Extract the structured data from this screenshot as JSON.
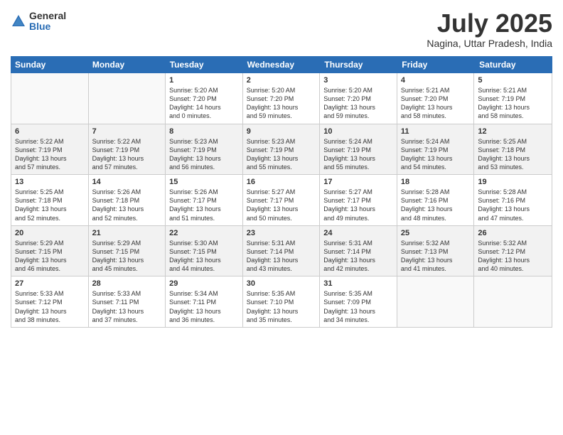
{
  "logo": {
    "general": "General",
    "blue": "Blue"
  },
  "title": "July 2025",
  "location": "Nagina, Uttar Pradesh, India",
  "weekdays": [
    "Sunday",
    "Monday",
    "Tuesday",
    "Wednesday",
    "Thursday",
    "Friday",
    "Saturday"
  ],
  "weeks": [
    [
      {
        "day": "",
        "info": "",
        "empty": true
      },
      {
        "day": "",
        "info": "",
        "empty": true
      },
      {
        "day": "1",
        "info": "Sunrise: 5:20 AM\nSunset: 7:20 PM\nDaylight: 14 hours\nand 0 minutes.",
        "empty": false
      },
      {
        "day": "2",
        "info": "Sunrise: 5:20 AM\nSunset: 7:20 PM\nDaylight: 13 hours\nand 59 minutes.",
        "empty": false
      },
      {
        "day": "3",
        "info": "Sunrise: 5:20 AM\nSunset: 7:20 PM\nDaylight: 13 hours\nand 59 minutes.",
        "empty": false
      },
      {
        "day": "4",
        "info": "Sunrise: 5:21 AM\nSunset: 7:20 PM\nDaylight: 13 hours\nand 58 minutes.",
        "empty": false
      },
      {
        "day": "5",
        "info": "Sunrise: 5:21 AM\nSunset: 7:19 PM\nDaylight: 13 hours\nand 58 minutes.",
        "empty": false
      }
    ],
    [
      {
        "day": "6",
        "info": "Sunrise: 5:22 AM\nSunset: 7:19 PM\nDaylight: 13 hours\nand 57 minutes.",
        "empty": false
      },
      {
        "day": "7",
        "info": "Sunrise: 5:22 AM\nSunset: 7:19 PM\nDaylight: 13 hours\nand 57 minutes.",
        "empty": false
      },
      {
        "day": "8",
        "info": "Sunrise: 5:23 AM\nSunset: 7:19 PM\nDaylight: 13 hours\nand 56 minutes.",
        "empty": false
      },
      {
        "day": "9",
        "info": "Sunrise: 5:23 AM\nSunset: 7:19 PM\nDaylight: 13 hours\nand 55 minutes.",
        "empty": false
      },
      {
        "day": "10",
        "info": "Sunrise: 5:24 AM\nSunset: 7:19 PM\nDaylight: 13 hours\nand 55 minutes.",
        "empty": false
      },
      {
        "day": "11",
        "info": "Sunrise: 5:24 AM\nSunset: 7:19 PM\nDaylight: 13 hours\nand 54 minutes.",
        "empty": false
      },
      {
        "day": "12",
        "info": "Sunrise: 5:25 AM\nSunset: 7:18 PM\nDaylight: 13 hours\nand 53 minutes.",
        "empty": false
      }
    ],
    [
      {
        "day": "13",
        "info": "Sunrise: 5:25 AM\nSunset: 7:18 PM\nDaylight: 13 hours\nand 52 minutes.",
        "empty": false
      },
      {
        "day": "14",
        "info": "Sunrise: 5:26 AM\nSunset: 7:18 PM\nDaylight: 13 hours\nand 52 minutes.",
        "empty": false
      },
      {
        "day": "15",
        "info": "Sunrise: 5:26 AM\nSunset: 7:17 PM\nDaylight: 13 hours\nand 51 minutes.",
        "empty": false
      },
      {
        "day": "16",
        "info": "Sunrise: 5:27 AM\nSunset: 7:17 PM\nDaylight: 13 hours\nand 50 minutes.",
        "empty": false
      },
      {
        "day": "17",
        "info": "Sunrise: 5:27 AM\nSunset: 7:17 PM\nDaylight: 13 hours\nand 49 minutes.",
        "empty": false
      },
      {
        "day": "18",
        "info": "Sunrise: 5:28 AM\nSunset: 7:16 PM\nDaylight: 13 hours\nand 48 minutes.",
        "empty": false
      },
      {
        "day": "19",
        "info": "Sunrise: 5:28 AM\nSunset: 7:16 PM\nDaylight: 13 hours\nand 47 minutes.",
        "empty": false
      }
    ],
    [
      {
        "day": "20",
        "info": "Sunrise: 5:29 AM\nSunset: 7:15 PM\nDaylight: 13 hours\nand 46 minutes.",
        "empty": false
      },
      {
        "day": "21",
        "info": "Sunrise: 5:29 AM\nSunset: 7:15 PM\nDaylight: 13 hours\nand 45 minutes.",
        "empty": false
      },
      {
        "day": "22",
        "info": "Sunrise: 5:30 AM\nSunset: 7:15 PM\nDaylight: 13 hours\nand 44 minutes.",
        "empty": false
      },
      {
        "day": "23",
        "info": "Sunrise: 5:31 AM\nSunset: 7:14 PM\nDaylight: 13 hours\nand 43 minutes.",
        "empty": false
      },
      {
        "day": "24",
        "info": "Sunrise: 5:31 AM\nSunset: 7:14 PM\nDaylight: 13 hours\nand 42 minutes.",
        "empty": false
      },
      {
        "day": "25",
        "info": "Sunrise: 5:32 AM\nSunset: 7:13 PM\nDaylight: 13 hours\nand 41 minutes.",
        "empty": false
      },
      {
        "day": "26",
        "info": "Sunrise: 5:32 AM\nSunset: 7:12 PM\nDaylight: 13 hours\nand 40 minutes.",
        "empty": false
      }
    ],
    [
      {
        "day": "27",
        "info": "Sunrise: 5:33 AM\nSunset: 7:12 PM\nDaylight: 13 hours\nand 38 minutes.",
        "empty": false
      },
      {
        "day": "28",
        "info": "Sunrise: 5:33 AM\nSunset: 7:11 PM\nDaylight: 13 hours\nand 37 minutes.",
        "empty": false
      },
      {
        "day": "29",
        "info": "Sunrise: 5:34 AM\nSunset: 7:11 PM\nDaylight: 13 hours\nand 36 minutes.",
        "empty": false
      },
      {
        "day": "30",
        "info": "Sunrise: 5:35 AM\nSunset: 7:10 PM\nDaylight: 13 hours\nand 35 minutes.",
        "empty": false
      },
      {
        "day": "31",
        "info": "Sunrise: 5:35 AM\nSunset: 7:09 PM\nDaylight: 13 hours\nand 34 minutes.",
        "empty": false
      },
      {
        "day": "",
        "info": "",
        "empty": true
      },
      {
        "day": "",
        "info": "",
        "empty": true
      }
    ]
  ]
}
